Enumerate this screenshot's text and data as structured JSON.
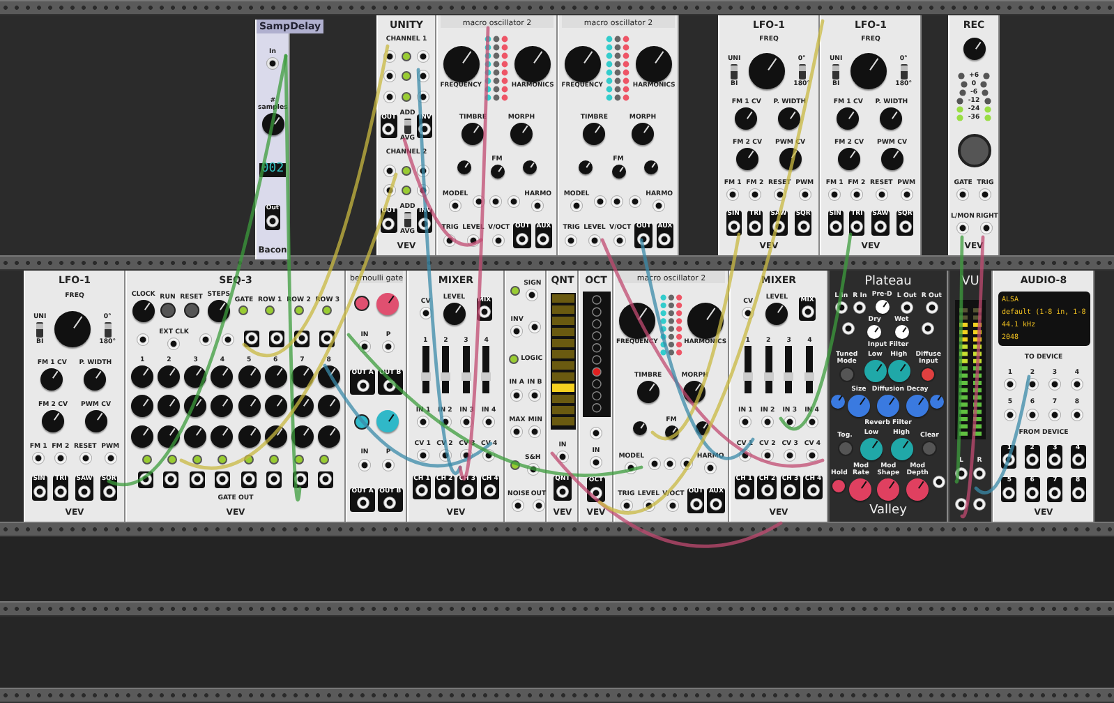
{
  "floating_module": {
    "title": "SampDelay",
    "footer": "Bacon",
    "rows": [
      {
        "items": [
          {
            "kind": "jack",
            "label": "In"
          }
        ]
      },
      {
        "items": [
          {
            "kind": "knob",
            "label": "# samples"
          }
        ]
      },
      {
        "items": [
          {
            "kind": "display",
            "label": "002"
          }
        ]
      },
      {
        "items": [
          {
            "kind": "out-jack",
            "label": "Out"
          }
        ]
      }
    ]
  },
  "top_row": [
    {
      "title": "UNITY",
      "footer": "VEV",
      "rows": [
        {
          "items": [
            {
              "kind": "text",
              "label": "CHANNEL 1"
            }
          ]
        },
        {
          "items": [
            {
              "kind": "jack"
            },
            {
              "kind": "light"
            },
            {
              "kind": "jack"
            }
          ]
        },
        {
          "items": [
            {
              "kind": "jack"
            },
            {
              "kind": "light"
            },
            {
              "kind": "jack"
            }
          ]
        },
        {
          "items": [
            {
              "kind": "jack"
            },
            {
              "kind": "light"
            },
            {
              "kind": "jack"
            }
          ]
        },
        {
          "items": [
            {
              "kind": "out-jack",
              "label": "OUT"
            },
            {
              "kind": "switch",
              "labels": [
                "ADD",
                "AVG"
              ],
              "up": true
            },
            {
              "kind": "out-jack",
              "label": "INV"
            }
          ]
        },
        {
          "items": [
            {
              "kind": "text",
              "label": "CHANNEL 2"
            }
          ]
        },
        {
          "items": [
            {
              "kind": "jack"
            },
            {
              "kind": "light"
            },
            {
              "kind": "jack"
            }
          ]
        },
        {
          "items": [
            {
              "kind": "jack"
            },
            {
              "kind": "light"
            },
            {
              "kind": "jack"
            }
          ]
        },
        {
          "items": [
            {
              "kind": "out-jack",
              "label": "OUT"
            },
            {
              "kind": "switch",
              "labels": [
                "ADD",
                "AVG"
              ],
              "up": true
            },
            {
              "kind": "out-jack",
              "label": "INV"
            }
          ]
        }
      ]
    },
    {
      "title": "macro oscillator 2",
      "rows": [
        {
          "items": [
            {
              "kind": "big-knob",
              "label": "FREQUENCY"
            },
            {
              "kind": "light-grid"
            },
            {
              "kind": "big-knob",
              "label": "HARMONICS"
            }
          ]
        },
        {
          "items": [
            {
              "kind": "knob",
              "label": "TIMBRE"
            },
            {
              "kind": "knob",
              "label": "MORPH"
            }
          ]
        },
        {
          "items": [
            {
              "kind": "small-knob"
            },
            {
              "kind": "small-knob",
              "label": "FM"
            },
            {
              "kind": "small-knob"
            }
          ]
        },
        {
          "items": [
            {
              "kind": "jack",
              "label": "MODEL"
            },
            {
              "kind": "jack"
            },
            {
              "kind": "jack"
            },
            {
              "kind": "jack"
            },
            {
              "kind": "jack",
              "label": "HARMO"
            }
          ]
        },
        {
          "items": [
            {
              "kind": "jack",
              "label": "TRIG"
            },
            {
              "kind": "jack",
              "label": "LEVEL"
            },
            {
              "kind": "jack",
              "label": "V/OCT"
            },
            {
              "kind": "out-jack",
              "label": "OUT"
            },
            {
              "kind": "out-jack",
              "label": "AUX"
            }
          ]
        }
      ]
    },
    {
      "title": "macro oscillator 2",
      "rows": [
        {
          "items": [
            {
              "kind": "big-knob",
              "label": "FREQUENCY"
            },
            {
              "kind": "light-grid"
            },
            {
              "kind": "big-knob",
              "label": "HARMONICS"
            }
          ]
        },
        {
          "items": [
            {
              "kind": "knob",
              "label": "TIMBRE"
            },
            {
              "kind": "knob",
              "label": "MORPH"
            }
          ]
        },
        {
          "items": [
            {
              "kind": "small-knob"
            },
            {
              "kind": "small-knob",
              "label": "FM"
            },
            {
              "kind": "small-knob"
            }
          ]
        },
        {
          "items": [
            {
              "kind": "jack",
              "label": "MODEL"
            },
            {
              "kind": "jack"
            },
            {
              "kind": "jack"
            },
            {
              "kind": "jack"
            },
            {
              "kind": "jack",
              "label": "HARMO"
            }
          ]
        },
        {
          "items": [
            {
              "kind": "jack",
              "label": "TRIG"
            },
            {
              "kind": "jack",
              "label": "LEVEL"
            },
            {
              "kind": "jack",
              "label": "V/OCT"
            },
            {
              "kind": "out-jack",
              "label": "OUT"
            },
            {
              "kind": "out-jack",
              "label": "AUX"
            }
          ]
        }
      ]
    },
    {
      "title": "LFO-1",
      "footer": "VEV",
      "rows": [
        {
          "items": [
            {
              "kind": "text",
              "label": "FREQ"
            }
          ]
        },
        {
          "items": [
            {
              "kind": "switch",
              "labels": [
                "UNI",
                "BI"
              ],
              "up": true
            },
            {
              "kind": "big-knob"
            },
            {
              "kind": "switch",
              "labels": [
                "0°",
                "180°"
              ],
              "up": true
            }
          ]
        },
        {
          "items": [
            {
              "kind": "knob",
              "label": "FM 1 CV"
            },
            {
              "kind": "knob",
              "label": "P. WIDTH"
            }
          ]
        },
        {
          "items": [
            {
              "kind": "knob",
              "label": "FM 2 CV"
            },
            {
              "kind": "knob",
              "label": "PWM CV"
            }
          ]
        },
        {
          "items": [
            {
              "kind": "jack",
              "label": "FM 1"
            },
            {
              "kind": "jack",
              "label": "FM 2"
            },
            {
              "kind": "jack",
              "label": "RESET"
            },
            {
              "kind": "jack",
              "label": "PWM"
            }
          ]
        },
        {
          "items": [
            {
              "kind": "out-jack",
              "label": "SIN"
            },
            {
              "kind": "out-jack",
              "label": "TRI"
            },
            {
              "kind": "out-jack",
              "label": "SAW"
            },
            {
              "kind": "out-jack",
              "label": "SQR"
            }
          ]
        }
      ]
    },
    {
      "title": "LFO-1",
      "footer": "VEV",
      "rows": [
        {
          "items": [
            {
              "kind": "text",
              "label": "FREQ"
            }
          ]
        },
        {
          "items": [
            {
              "kind": "switch",
              "labels": [
                "UNI",
                "BI"
              ],
              "up": true
            },
            {
              "kind": "big-knob"
            },
            {
              "kind": "switch",
              "labels": [
                "0°",
                "180°"
              ],
              "up": true
            }
          ]
        },
        {
          "items": [
            {
              "kind": "knob",
              "label": "FM 1 CV"
            },
            {
              "kind": "knob",
              "label": "P. WIDTH"
            }
          ]
        },
        {
          "items": [
            {
              "kind": "knob",
              "label": "FM 2 CV"
            },
            {
              "kind": "knob",
              "label": "PWM CV"
            }
          ]
        },
        {
          "items": [
            {
              "kind": "jack",
              "label": "FM 1"
            },
            {
              "kind": "jack",
              "label": "FM 2"
            },
            {
              "kind": "jack",
              "label": "RESET"
            },
            {
              "kind": "jack",
              "label": "PWM"
            }
          ]
        },
        {
          "items": [
            {
              "kind": "out-jack",
              "label": "SIN"
            },
            {
              "kind": "out-jack",
              "label": "TRI"
            },
            {
              "kind": "out-jack",
              "label": "SAW"
            },
            {
              "kind": "out-jack",
              "label": "SQR"
            }
          ]
        }
      ]
    },
    {
      "title": "REC",
      "footer": "VEV",
      "rows": [
        {
          "items": [
            {
              "kind": "knob"
            }
          ]
        },
        {
          "items": [
            {
              "kind": "led-meter",
              "labels": [
                "+6",
                "0",
                "-6",
                "-12",
                "-24",
                "-36"
              ]
            }
          ]
        },
        {
          "items": [
            {
              "kind": "record-button"
            }
          ]
        },
        {
          "items": [
            {
              "kind": "jack",
              "label": "GATE"
            },
            {
              "kind": "jack",
              "label": "TRIG"
            }
          ]
        },
        {
          "items": [
            {
              "kind": "jack",
              "label": "L/MON"
            },
            {
              "kind": "jack",
              "label": "RIGHT"
            }
          ]
        }
      ]
    }
  ],
  "bottom_row": [
    {
      "title": "LFO-1",
      "footer": "VEV",
      "rows": [
        {
          "items": [
            {
              "kind": "text",
              "label": "FREQ"
            }
          ]
        },
        {
          "items": [
            {
              "kind": "switch",
              "labels": [
                "UNI",
                "BI"
              ],
              "up": true
            },
            {
              "kind": "big-knob"
            },
            {
              "kind": "switch",
              "labels": [
                "0°",
                "180°"
              ],
              "up": true
            }
          ]
        },
        {
          "items": [
            {
              "kind": "knob",
              "label": "FM 1 CV"
            },
            {
              "kind": "knob",
              "label": "P. WIDTH"
            }
          ]
        },
        {
          "items": [
            {
              "kind": "knob",
              "label": "FM 2 CV"
            },
            {
              "kind": "knob",
              "label": "PWM CV"
            }
          ]
        },
        {
          "items": [
            {
              "kind": "jack",
              "label": "FM 1"
            },
            {
              "kind": "jack",
              "label": "FM 2"
            },
            {
              "kind": "jack",
              "label": "RESET"
            },
            {
              "kind": "jack",
              "label": "PWM"
            }
          ]
        },
        {
          "items": [
            {
              "kind": "out-jack",
              "label": "SIN"
            },
            {
              "kind": "out-jack",
              "label": "TRI"
            },
            {
              "kind": "out-jack",
              "label": "SAW"
            },
            {
              "kind": "out-jack",
              "label": "SQR"
            }
          ]
        }
      ]
    },
    {
      "title": "SEQ-3",
      "footer": "VEV",
      "rows": [
        {
          "items": [
            {
              "kind": "knob",
              "label": "CLOCK"
            },
            {
              "kind": "button",
              "label": "RUN"
            },
            {
              "kind": "button",
              "label": "RESET"
            },
            {
              "kind": "knob",
              "label": "STEPS"
            },
            {
              "kind": "light",
              "label": "GATE"
            },
            {
              "kind": "light",
              "label": "ROW 1"
            },
            {
              "kind": "light",
              "label": "ROW 2"
            },
            {
              "kind": "light",
              "label": "ROW 3"
            }
          ]
        },
        {
          "items": [
            {
              "kind": "jack"
            },
            {
              "kind": "jack",
              "label": "EXT CLK"
            },
            {
              "kind": "jack"
            },
            {
              "kind": "jack"
            },
            {
              "kind": "out-jack"
            },
            {
              "kind": "out-jack"
            },
            {
              "kind": "out-jack"
            },
            {
              "kind": "out-jack"
            }
          ]
        },
        {
          "items": [
            {
              "kind": "knob",
              "label": "1"
            },
            {
              "kind": "knob",
              "label": "2"
            },
            {
              "kind": "knob",
              "label": "3"
            },
            {
              "kind": "knob",
              "label": "4"
            },
            {
              "kind": "knob",
              "label": "5"
            },
            {
              "kind": "knob",
              "label": "6"
            },
            {
              "kind": "knob",
              "label": "7"
            },
            {
              "kind": "knob",
              "label": "8"
            }
          ]
        },
        {
          "items": [
            {
              "kind": "knob"
            },
            {
              "kind": "knob"
            },
            {
              "kind": "knob"
            },
            {
              "kind": "knob"
            },
            {
              "kind": "knob"
            },
            {
              "kind": "knob"
            },
            {
              "kind": "knob"
            },
            {
              "kind": "knob"
            }
          ]
        },
        {
          "items": [
            {
              "kind": "knob"
            },
            {
              "kind": "knob"
            },
            {
              "kind": "knob"
            },
            {
              "kind": "knob"
            },
            {
              "kind": "knob"
            },
            {
              "kind": "knob"
            },
            {
              "kind": "knob"
            },
            {
              "kind": "knob"
            }
          ]
        },
        {
          "items": [
            {
              "kind": "light"
            },
            {
              "kind": "light"
            },
            {
              "kind": "light"
            },
            {
              "kind": "light"
            },
            {
              "kind": "light"
            },
            {
              "kind": "light"
            },
            {
              "kind": "light"
            },
            {
              "kind": "light"
            }
          ]
        },
        {
          "items": [
            {
              "kind": "out-jack"
            },
            {
              "kind": "out-jack"
            },
            {
              "kind": "out-jack"
            },
            {
              "kind": "out-jack"
            },
            {
              "kind": "out-jack"
            },
            {
              "kind": "out-jack"
            },
            {
              "kind": "out-jack"
            },
            {
              "kind": "out-jack"
            }
          ]
        },
        {
          "items": [
            {
              "kind": "text",
              "label": "GATE OUT"
            }
          ]
        }
      ]
    },
    {
      "title": "bernoulli gate",
      "rows": [
        {
          "items": [
            {
              "kind": "button",
              "color": "#e05070"
            },
            {
              "kind": "knob",
              "color": "#e05070"
            }
          ]
        },
        {
          "items": [
            {
              "kind": "jack",
              "label": "IN"
            },
            {
              "kind": "jack",
              "label": "P"
            }
          ]
        },
        {
          "items": [
            {
              "kind": "out-jack",
              "label": "OUT A"
            },
            {
              "kind": "out-jack",
              "label": "OUT B"
            }
          ]
        },
        {
          "items": [
            {
              "kind": "button",
              "color": "#30b8c8"
            },
            {
              "kind": "knob",
              "color": "#30b8c8"
            }
          ]
        },
        {
          "items": [
            {
              "kind": "jack",
              "label": "IN"
            },
            {
              "kind": "jack",
              "label": "P"
            }
          ]
        },
        {
          "items": [
            {
              "kind": "out-jack",
              "label": "OUT A"
            },
            {
              "kind": "out-jack",
              "label": "OUT B"
            }
          ]
        }
      ]
    },
    {
      "title": "MIXER",
      "footer": "VEV",
      "rows": [
        {
          "items": [
            {
              "kind": "jack",
              "label": "CV"
            },
            {
              "kind": "knob",
              "label": "LEVEL"
            },
            {
              "kind": "out-jack",
              "label": "MIX"
            }
          ]
        },
        {
          "items": [
            {
              "kind": "slider",
              "label": "1"
            },
            {
              "kind": "slider",
              "label": "2"
            },
            {
              "kind": "slider",
              "label": "3"
            },
            {
              "kind": "slider",
              "label": "4"
            }
          ]
        },
        {
          "items": [
            {
              "kind": "jack",
              "label": "IN 1"
            },
            {
              "kind": "jack",
              "label": "IN 2"
            },
            {
              "kind": "jack",
              "label": "IN 3"
            },
            {
              "kind": "jack",
              "label": "IN 4"
            }
          ]
        },
        {
          "items": [
            {
              "kind": "jack",
              "label": "CV 1"
            },
            {
              "kind": "jack",
              "label": "CV 2"
            },
            {
              "kind": "jack",
              "label": "CV 3"
            },
            {
              "kind": "jack",
              "label": "CV 4"
            }
          ]
        },
        {
          "items": [
            {
              "kind": "out-jack",
              "label": "CH 1"
            },
            {
              "kind": "out-jack",
              "label": "CH 2"
            },
            {
              "kind": "out-jack",
              "label": "CH 3"
            },
            {
              "kind": "out-jack",
              "label": "CH 4"
            }
          ]
        }
      ]
    },
    {
      "rows": [
        {
          "items": [
            {
              "kind": "light"
            },
            {
              "kind": "jack",
              "label": "SIGN"
            }
          ]
        },
        {
          "items": [
            {
              "kind": "jack",
              "label": "INV"
            },
            {
              "kind": "jack"
            }
          ]
        },
        {
          "items": [
            {
              "kind": "light"
            },
            {
              "kind": "text",
              "label": "LOGIC"
            }
          ]
        },
        {
          "items": [
            {
              "kind": "jack",
              "label": "IN A"
            },
            {
              "kind": "jack",
              "label": "IN B"
            }
          ]
        },
        {
          "items": [
            {
              "kind": "jack",
              "label": "MAX"
            },
            {
              "kind": "jack",
              "label": "MIN"
            }
          ]
        },
        {
          "items": [
            {
              "kind": "light"
            },
            {
              "kind": "jack",
              "label": "S&H"
            }
          ]
        },
        {
          "items": [
            {
              "kind": "jack",
              "label": "NOISE"
            },
            {
              "kind": "jack",
              "label": "OUT"
            }
          ]
        }
      ]
    },
    {
      "title": "QNT",
      "footer": "VEV",
      "rows": [
        {
          "items": [
            {
              "kind": "note-bars"
            }
          ]
        },
        {
          "items": [
            {
              "kind": "jack",
              "label": "IN"
            }
          ]
        },
        {
          "items": [
            {
              "kind": "out-jack",
              "label": "QNT"
            }
          ]
        }
      ]
    },
    {
      "title": "OCT",
      "footer": "VEV",
      "rows": [
        {
          "items": [
            {
              "kind": "octave-lights"
            }
          ]
        },
        {
          "items": [
            {
              "kind": "jack"
            }
          ]
        },
        {
          "items": [
            {
              "kind": "jack",
              "label": "IN"
            }
          ]
        },
        {
          "items": [
            {
              "kind": "out-jack",
              "label": "OCT"
            }
          ]
        }
      ]
    },
    {
      "title": "macro oscillator 2",
      "rows": [
        {
          "items": [
            {
              "kind": "big-knob",
              "label": "FREQUENCY"
            },
            {
              "kind": "light-grid"
            },
            {
              "kind": "big-knob",
              "label": "HARMONICS"
            }
          ]
        },
        {
          "items": [
            {
              "kind": "knob",
              "label": "TIMBRE"
            },
            {
              "kind": "knob",
              "label": "MORPH"
            }
          ]
        },
        {
          "items": [
            {
              "kind": "small-knob"
            },
            {
              "kind": "small-knob",
              "label": "FM"
            },
            {
              "kind": "small-knob"
            }
          ]
        },
        {
          "items": [
            {
              "kind": "jack",
              "label": "MODEL"
            },
            {
              "kind": "jack"
            },
            {
              "kind": "jack"
            },
            {
              "kind": "jack"
            },
            {
              "kind": "jack",
              "label": "HARMO"
            }
          ]
        },
        {
          "items": [
            {
              "kind": "jack",
              "label": "TRIG"
            },
            {
              "kind": "jack",
              "label": "LEVEL"
            },
            {
              "kind": "jack",
              "label": "V/OCT"
            },
            {
              "kind": "out-jack",
              "label": "OUT"
            },
            {
              "kind": "out-jack",
              "label": "AUX"
            }
          ]
        }
      ]
    },
    {
      "title": "MIXER",
      "footer": "VEV",
      "rows": [
        {
          "items": [
            {
              "kind": "jack",
              "label": "CV"
            },
            {
              "kind": "knob",
              "label": "LEVEL"
            },
            {
              "kind": "out-jack",
              "label": "MIX"
            }
          ]
        },
        {
          "items": [
            {
              "kind": "slider",
              "label": "1"
            },
            {
              "kind": "slider",
              "label": "2"
            },
            {
              "kind": "slider",
              "label": "3"
            },
            {
              "kind": "slider",
              "label": "4"
            }
          ]
        },
        {
          "items": [
            {
              "kind": "jack",
              "label": "IN 1"
            },
            {
              "kind": "jack",
              "label": "IN 2"
            },
            {
              "kind": "jack",
              "label": "IN 3"
            },
            {
              "kind": "jack",
              "label": "IN 4"
            }
          ]
        },
        {
          "items": [
            {
              "kind": "jack",
              "label": "CV 1"
            },
            {
              "kind": "jack",
              "label": "CV 2"
            },
            {
              "kind": "jack",
              "label": "CV 3"
            },
            {
              "kind": "jack",
              "label": "CV 4"
            }
          ]
        },
        {
          "items": [
            {
              "kind": "out-jack",
              "label": "CH 1"
            },
            {
              "kind": "out-jack",
              "label": "CH 2"
            },
            {
              "kind": "out-jack",
              "label": "CH 3"
            },
            {
              "kind": "out-jack",
              "label": "CH 4"
            }
          ]
        }
      ]
    },
    {
      "title": "Plateau",
      "footer": "Valley",
      "rows": [
        {
          "items": [
            {
              "kind": "jack",
              "label": "L In"
            },
            {
              "kind": "jack",
              "label": "R In"
            },
            {
              "kind": "small-knob",
              "label": "Pre-D",
              "color": "#ffffff"
            },
            {
              "kind": "jack",
              "label": "L Out"
            },
            {
              "kind": "jack",
              "label": "R Out"
            }
          ]
        },
        {
          "items": [
            {
              "kind": "jack"
            },
            {
              "kind": "small-knob",
              "label": "Dry",
              "color": "#ffffff"
            },
            {
              "kind": "small-knob",
              "label": "Wet",
              "color": "#ffffff"
            },
            {
              "kind": "jack"
            }
          ]
        },
        {
          "items": [
            {
              "kind": "text",
              "label": "Input Filter"
            }
          ]
        },
        {
          "items": [
            {
              "kind": "button",
              "label": "Tuned Mode"
            },
            {
              "kind": "knob",
              "label": "Low",
              "color": "#20a8a8"
            },
            {
              "kind": "knob",
              "label": "High",
              "color": "#20a8a8"
            },
            {
              "kind": "button",
              "label": "Diffuse Input",
              "color": "#e04040"
            }
          ]
        },
        {
          "items": [
            {
              "kind": "small-knob",
              "color": "#3a7ae0"
            },
            {
              "kind": "knob",
              "label": "Size",
              "color": "#3a7ae0"
            },
            {
              "kind": "knob",
              "label": "Diffusion",
              "color": "#3a7ae0"
            },
            {
              "kind": "knob",
              "label": "Decay",
              "color": "#3a7ae0"
            },
            {
              "kind": "small-knob",
              "color": "#3a7ae0"
            }
          ]
        },
        {
          "items": [
            {
              "kind": "text",
              "label": "Reverb Filter"
            }
          ]
        },
        {
          "items": [
            {
              "kind": "button",
              "label": "Tog."
            },
            {
              "kind": "knob",
              "label": "Low",
              "color": "#20a8a8"
            },
            {
              "kind": "knob",
              "label": "High",
              "color": "#20a8a8"
            },
            {
              "kind": "button",
              "label": "Clear"
            }
          ]
        },
        {
          "items": [
            {
              "kind": "button",
              "label": "Hold",
              "color": "#e04060"
            },
            {
              "kind": "knob",
              "label": "Mod Rate",
              "color": "#e04060"
            },
            {
              "kind": "knob",
              "label": "Mod Shape",
              "color": "#e04060"
            },
            {
              "kind": "knob",
              "label": "Mod Depth",
              "color": "#e04060"
            },
            {
              "kind": "jack"
            }
          ]
        }
      ]
    },
    {
      "title": "VU",
      "rows": [
        {
          "items": [
            {
              "kind": "vu-meter"
            }
          ]
        },
        {
          "items": [
            {
              "kind": "jack",
              "label": "L"
            },
            {
              "kind": "jack",
              "label": "R"
            }
          ]
        },
        {
          "items": [
            {
              "kind": "jack"
            },
            {
              "kind": "jack"
            }
          ]
        }
      ]
    },
    {
      "title": "AUDIO-8",
      "footer": "VEV",
      "rows": [
        {
          "items": [
            {
              "kind": "screen",
              "lines": [
                "ALSA",
                "default (1-8 in, 1-8",
                "44.1 kHz",
                "2048"
              ]
            }
          ]
        },
        {
          "items": [
            {
              "kind": "text",
              "label": "TO DEVICE"
            }
          ]
        },
        {
          "items": [
            {
              "kind": "jack",
              "label": "1"
            },
            {
              "kind": "jack",
              "label": "2"
            },
            {
              "kind": "jack",
              "label": "3"
            },
            {
              "kind": "jack",
              "label": "4"
            }
          ]
        },
        {
          "items": [
            {
              "kind": "jack",
              "label": "5"
            },
            {
              "kind": "jack",
              "label": "6"
            },
            {
              "kind": "jack",
              "label": "7"
            },
            {
              "kind": "jack",
              "label": "8"
            }
          ]
        },
        {
          "items": [
            {
              "kind": "text",
              "label": "FROM DEVICE"
            }
          ]
        },
        {
          "items": [
            {
              "kind": "out-jack",
              "label": "1"
            },
            {
              "kind": "out-jack",
              "label": "2"
            },
            {
              "kind": "out-jack",
              "label": "3"
            },
            {
              "kind": "out-jack",
              "label": "4"
            }
          ]
        },
        {
          "items": [
            {
              "kind": "out-jack",
              "label": "5"
            },
            {
              "kind": "out-jack",
              "label": "6"
            },
            {
              "kind": "out-jack",
              "label": "7"
            },
            {
              "kind": "out-jack",
              "label": "8"
            }
          ]
        }
      ]
    }
  ]
}
